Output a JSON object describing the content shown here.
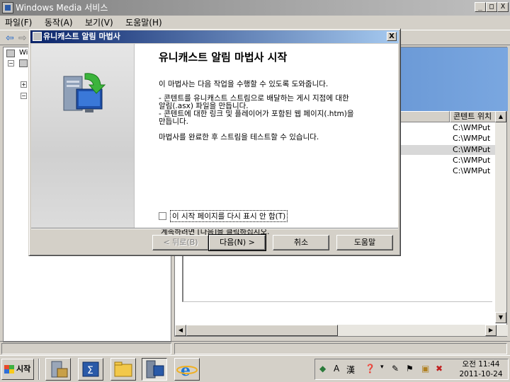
{
  "window": {
    "title": "Windows Media 서비스",
    "minimize": "_",
    "maximize": "□",
    "close": "X"
  },
  "menu": [
    "파일(F)",
    "동작(A)",
    "보기(V)",
    "도움말(H)"
  ],
  "tree": {
    "root_label": "Wi"
  },
  "list": {
    "column_header": "콘텐트 위치",
    "rows": [
      "C:\\WMPut",
      "C:\\WMPut",
      "C:\\WMPut",
      "C:\\WMPut",
      "C:\\WMPut"
    ],
    "selected_index": 2
  },
  "dialog": {
    "title": "유니캐스트 알림 마법사",
    "close": "X",
    "heading": "유니캐스트 알림 마법사 시작",
    "intro": "이 마법사는 다음 작업을 수행할 수 있도록 도와줍니다.",
    "bullet1_line1": "- 콘텐트를 유니캐스트 스트림으로 배달하는 게시 지점에 대한",
    "bullet1_line2": "알림(.asx) 파일을 만듭니다.",
    "bullet2_line1": "- 콘텐트에 대한 링크 및 플레이어가 포함된 웹 페이지(.htm)을",
    "bullet2_line2": "만듭니다.",
    "finish_text": "마법사를 완료한 후 스트림을 테스트할 수 있습니다.",
    "checkbox_label": "이 시작 페이지를 다시 표시 안 함(T)",
    "checkbox_checked": false,
    "continue_text": "계속하려면 [다음]을 클릭하십시오.",
    "buttons": {
      "back": "< 뒤로(B)",
      "next": "다음(N) >",
      "cancel": "취소",
      "help": "도움말"
    }
  },
  "taskbar": {
    "start": "시작",
    "ime_a": "A",
    "ime_han": "漢",
    "clock_line1": "오전 11:44",
    "clock_line2": "2011-10-24"
  }
}
